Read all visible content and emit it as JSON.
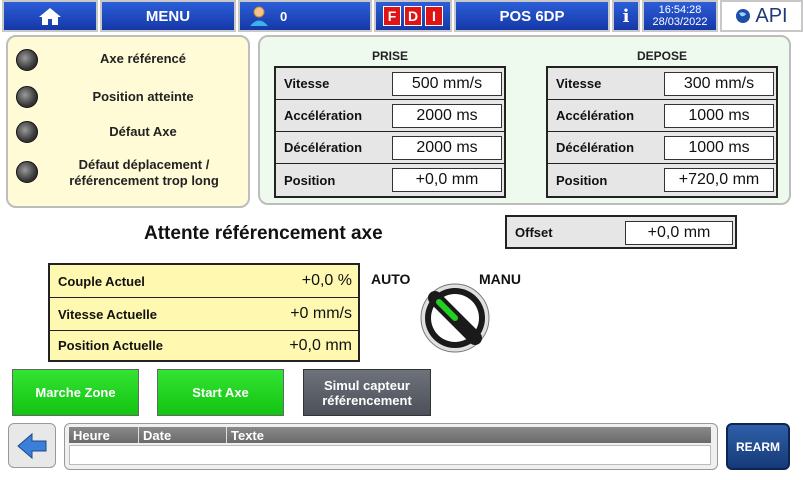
{
  "header": {
    "menu_label": "MENU",
    "user_count": "0",
    "fdi": [
      "F",
      "D",
      "I"
    ],
    "screen_title": "POS 6DP",
    "info_label": "i",
    "time": "16:54:28",
    "date": "28/03/2022",
    "logo_text": "API"
  },
  "status": {
    "items": [
      {
        "label": "Axe référencé"
      },
      {
        "label": "Position atteinte"
      },
      {
        "label": "Défaut Axe"
      },
      {
        "label": "Défaut déplacement / référencement trop long"
      }
    ]
  },
  "prise": {
    "title": "PRISE",
    "rows": [
      {
        "label": "Vitesse",
        "value": "500 mm/s"
      },
      {
        "label": "Accélération",
        "value": "2000 ms"
      },
      {
        "label": "Décélération",
        "value": "2000 ms"
      },
      {
        "label": "Position",
        "value": "+0,0 mm"
      }
    ]
  },
  "depose": {
    "title": "DEPOSE",
    "rows": [
      {
        "label": "Vitesse",
        "value": "300 mm/s"
      },
      {
        "label": "Accélération",
        "value": "1000 ms"
      },
      {
        "label": "Décélération",
        "value": "1000 ms"
      },
      {
        "label": "Position",
        "value": "+720,0 mm"
      }
    ]
  },
  "main_status": "Attente référencement axe",
  "offset": {
    "label": "Offset",
    "value": "+0,0 mm"
  },
  "actuals": {
    "rows": [
      {
        "label": "Couple Actuel",
        "value": "+0,0 %"
      },
      {
        "label": "Vitesse Actuelle",
        "value": "+0 mm/s"
      },
      {
        "label": "Position Actuelle",
        "value": "+0,0 mm"
      }
    ]
  },
  "mode": {
    "auto_label": "AUTO",
    "manu_label": "MANU",
    "selected": "AUTO"
  },
  "buttons": {
    "marche_zone": "Marche Zone",
    "start_axe": "Start Axe",
    "simul_line1": "Simul capteur",
    "simul_line2": "référencement",
    "rearm": "REARM"
  },
  "alarms": {
    "columns": [
      "Heure",
      "Date",
      "Texte"
    ]
  },
  "colors": {
    "header_blue": "#1e48c4",
    "accent_green": "#1ad01a",
    "fdi_red": "#e01414"
  }
}
